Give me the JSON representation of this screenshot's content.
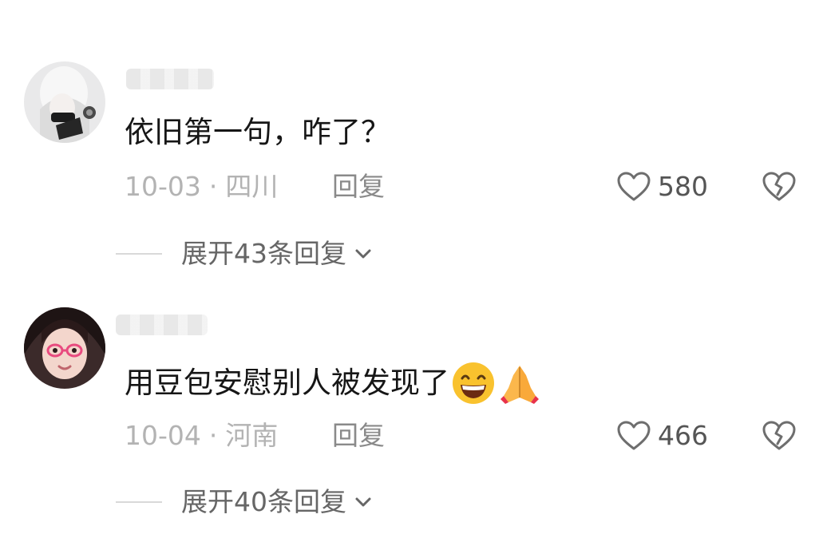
{
  "comments": [
    {
      "text": "依旧第一句，咋了？",
      "emojis": [],
      "date": "10-03",
      "location": "四川",
      "reply_label": "回复",
      "likes": "580",
      "expand_label": "展开43条回复"
    },
    {
      "text": "用豆包安慰别人被发现了",
      "emojis": [
        "grinning-face-emoji",
        "folded-hands-emoji"
      ],
      "date": "10-04",
      "location": "河南",
      "reply_label": "回复",
      "likes": "466",
      "expand_label": "展开40条回复"
    }
  ],
  "separator": "·",
  "icons": {
    "like": "heart-outline-icon",
    "dislike": "broken-heart-icon",
    "expand": "chevron-down-icon"
  },
  "colors": {
    "meta_text": "#b3b3b3",
    "reply_text": "#8a8a8a",
    "icon_stroke": "#6e6e6e"
  }
}
